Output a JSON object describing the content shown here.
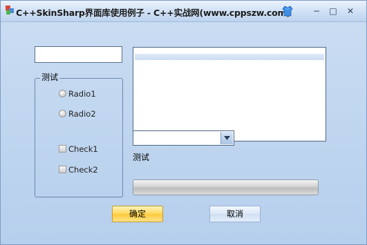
{
  "window": {
    "title": "C++SkinSharp界面库使用例子 - C++实战网(www.cppszw.com)",
    "minimize_glyph": "−",
    "maximize_glyph": "□",
    "close_glyph": "✕",
    "icons": {
      "app": "app-icon",
      "skin": "skin-shirt-icon"
    }
  },
  "groupbox": {
    "label": "测试",
    "radios": [
      {
        "label": "Radio1",
        "checked": false
      },
      {
        "label": "Radio2",
        "checked": false
      }
    ],
    "checkboxes": [
      {
        "label": "Check1",
        "checked": false
      },
      {
        "label": "Check2",
        "checked": false
      }
    ]
  },
  "textbox": {
    "value": ""
  },
  "combobox": {
    "value": ""
  },
  "static_label": "测试",
  "progress": {
    "value_fraction": 0
  },
  "buttons": {
    "ok": "确定",
    "cancel": "取消"
  },
  "colors": {
    "window_bg": "#bfd6ef",
    "ok_button": "#ffd85c",
    "cancel_button": "#dce8f6"
  }
}
